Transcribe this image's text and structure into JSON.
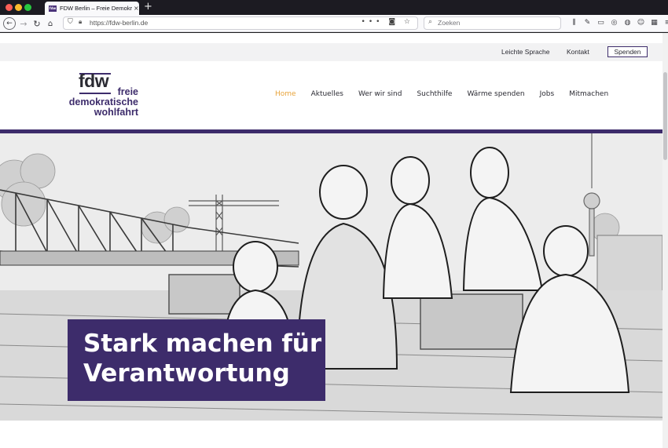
{
  "browser": {
    "tab_favicon_text": "fdw",
    "tab_title": "FDW Berlin – Freie Demokratische Wohlfahrt",
    "tab_close": "×",
    "new_tab": "+",
    "url": "https://fdw-berlin.de",
    "search_placeholder": "Zoeken",
    "url_actions": "••• ◙ ☆"
  },
  "utility": {
    "easy_language": "Leichte Sprache",
    "contact": "Kontakt",
    "donate": "Spenden"
  },
  "logo": {
    "abbr": "fdw",
    "line1": "freie",
    "line2": "demokratische",
    "line3": "wohlfahrt"
  },
  "nav": {
    "items": [
      {
        "label": "Home",
        "active": true
      },
      {
        "label": "Aktuelles",
        "active": false
      },
      {
        "label": "Wer wir sind",
        "active": false
      },
      {
        "label": "Suchthilfe",
        "active": false
      },
      {
        "label": "Wärme spenden",
        "active": false
      },
      {
        "label": "Jobs",
        "active": false
      },
      {
        "label": "Mitmachen",
        "active": false
      }
    ]
  },
  "hero": {
    "line1": "Stark machen für",
    "line2": "Verantwortung"
  },
  "colors": {
    "brand_purple": "#3d2c6b",
    "nav_active": "#e8a43b"
  },
  "icons": [
    "back-icon",
    "forward-icon",
    "reload-icon",
    "home-icon",
    "shield-icon",
    "lock-icon",
    "search-icon",
    "library-icon",
    "sidebar-icon",
    "account-icon",
    "menu-icon"
  ]
}
